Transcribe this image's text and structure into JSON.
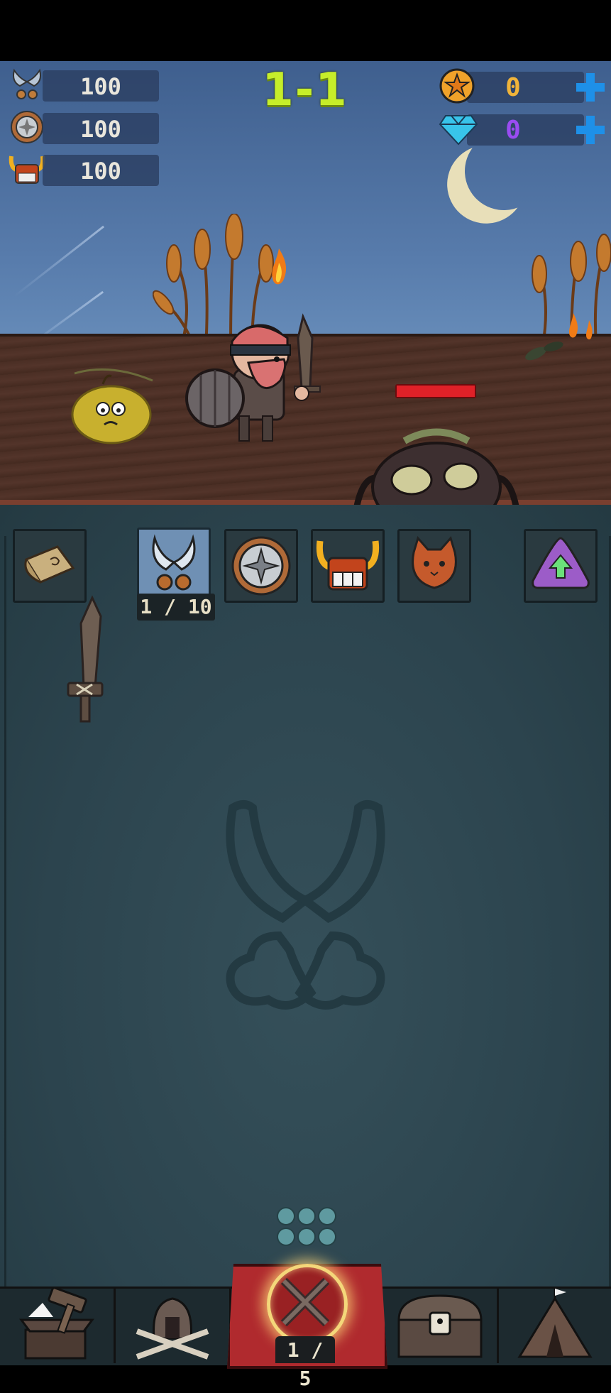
{
  "hud": {
    "stats": [
      {
        "name": "attack",
        "icon": "crossed-axes-icon",
        "value": "100"
      },
      {
        "name": "defense",
        "icon": "round-shield-icon",
        "value": "100"
      },
      {
        "name": "health",
        "icon": "horned-helmet-icon",
        "value": "100"
      }
    ],
    "stage": "1-1",
    "currencies": [
      {
        "name": "gold",
        "icon": "gold-star-coin-icon",
        "value": "0",
        "color": "#f0b43a"
      },
      {
        "name": "gems",
        "icon": "blue-diamond-icon",
        "value": "0",
        "color": "#9a4cf2"
      }
    ]
  },
  "battle": {
    "enemy_health_fraction": 1.0
  },
  "equipment_tabs": [
    {
      "id": "scroll",
      "icon": "scroll-icon",
      "active": false
    },
    {
      "id": "weapon",
      "icon": "crossed-axes-icon",
      "active": true,
      "count": "1 / 10"
    },
    {
      "id": "shield",
      "icon": "round-shield-icon",
      "active": false
    },
    {
      "id": "helmet",
      "icon": "horned-helmet-icon",
      "active": false
    },
    {
      "id": "pet",
      "icon": "cat-head-icon",
      "active": false
    },
    {
      "id": "upgrade",
      "icon": "upgrade-arrow-icon",
      "active": false
    }
  ],
  "inventory": {
    "items": [
      {
        "icon": "wooden-sword-icon"
      }
    ],
    "empty_placeholder_icon": "crossed-axes-watermark-icon"
  },
  "bottom_nav": {
    "items": [
      {
        "id": "forge",
        "icon": "anvil-hammer-icon"
      },
      {
        "id": "heroes",
        "icon": "helmet-swords-icon"
      },
      {
        "id": "battle",
        "icon": "crossed-swords-icon",
        "count": "1 / 5"
      },
      {
        "id": "chest",
        "icon": "treasure-chest-icon"
      },
      {
        "id": "camp",
        "icon": "tent-icon"
      }
    ]
  }
}
